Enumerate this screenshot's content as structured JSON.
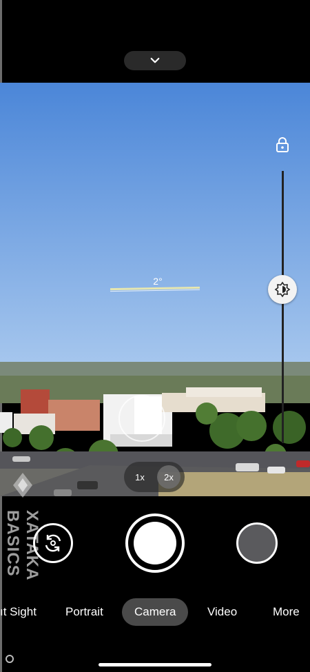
{
  "viewfinder": {
    "level_angle_label": "2°",
    "zoom": {
      "option_1x": "1x",
      "option_2x": "2x",
      "selected": "2x"
    },
    "exposure_level": 0.5
  },
  "modes": {
    "items": [
      "Night Sight",
      "Portrait",
      "Camera",
      "Video",
      "More"
    ],
    "night_sight_visible_text": "ıt Sight",
    "portrait": "Portrait",
    "camera": "Camera",
    "video": "Video",
    "more": "More",
    "selected": "Camera"
  },
  "watermark": {
    "text": "XATAKA BASICS"
  },
  "icons": {
    "top": "chevron-down-icon",
    "lock": "lock-icon",
    "exposure": "brightness-icon",
    "switch_camera": "switch-camera-icon",
    "shutter": "shutter-button",
    "thumbnail": "gallery-thumbnail"
  },
  "colors": {
    "sky_top": "#4b86d8",
    "sky_bottom": "#a8c8ee",
    "ui_background": "#000000",
    "accent": "#ffffff"
  }
}
